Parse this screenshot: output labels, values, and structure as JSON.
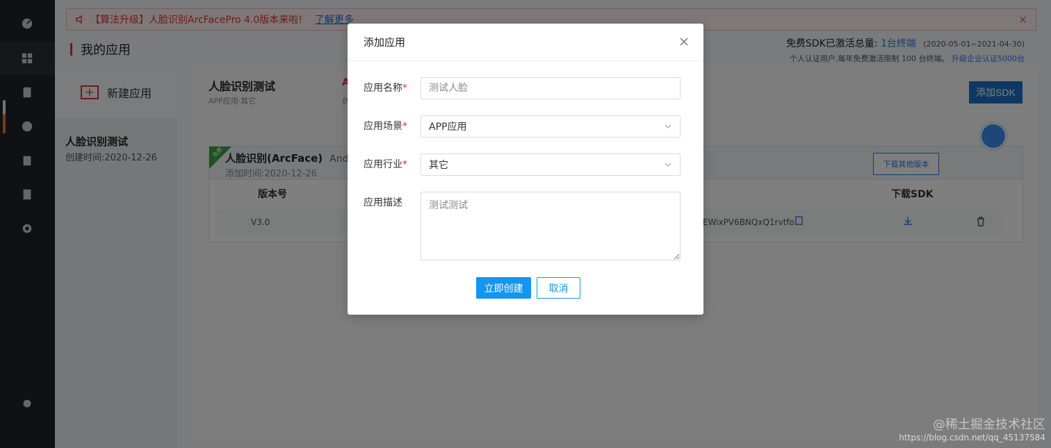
{
  "notice": {
    "text": "【算法升级】人脸识别ArcFacePro 4.0版本来啦!",
    "link": "了解更多",
    "close": "×"
  },
  "page": {
    "title": "我的应用"
  },
  "quota": {
    "label": "免费SDK已激活总量:",
    "value": "1台终端",
    "range": "(2020-05-01~2021-04-30)",
    "sub": "个人认证用户,每年免费激活限制 100 台终端。",
    "upgrade": "升级企业认证5000台"
  },
  "left": {
    "new_app": "新建应用",
    "app_name": "人脸识别测试",
    "app_created": "创建时间:2020-12-26"
  },
  "content": {
    "app_name": "人脸识别测试",
    "app_meta": "APP应用·其它",
    "red_text": "A",
    "red_sub": "创",
    "add_sdk": "添加SDK",
    "sdk": {
      "badge": "免费",
      "title": "人脸识别(ArcFace)",
      "title_suffix": "And",
      "date": "添加时间:2020-12-26",
      "other_versions": "下载其他版本",
      "col_version": "版本号",
      "col_download": "下载SDK",
      "row_version": "V3.0",
      "row_key": "EWixPV6BNQxQ1rvtfo..."
    }
  },
  "modal": {
    "title": "添加应用",
    "name_label": "应用名称",
    "name_placeholder": "测试人脸",
    "scene_label": "应用场景",
    "scene_value": "APP应用",
    "industry_label": "应用行业",
    "industry_value": "其它",
    "desc_label": "应用描述",
    "desc_placeholder": "测试测试",
    "required_mark": "*",
    "submit": "立即创建",
    "cancel": "取消"
  },
  "watermark": {
    "line1": "@稀土掘金技术社区",
    "line2": "https://blog.csdn.net/qq_45137584"
  }
}
